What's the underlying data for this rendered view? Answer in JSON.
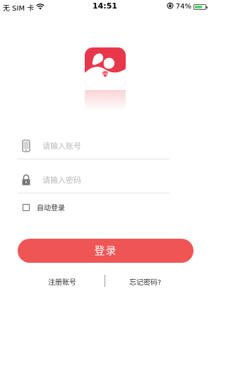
{
  "status_bar": {
    "carrier": "无 SIM 卡",
    "time": "14:51",
    "battery_percent": "74%",
    "battery_level": 0.74,
    "icons": [
      "wifi-icon",
      "orientation-lock-icon",
      "battery-icon"
    ]
  },
  "app": {
    "logo_icon": "app-logo-icon",
    "brand_color": "#e8374a"
  },
  "form": {
    "account": {
      "icon": "phone-icon",
      "placeholder": "请输入账号",
      "value": ""
    },
    "password": {
      "icon": "lock-icon",
      "placeholder": "请输入密码",
      "value": ""
    },
    "remember_label": "自动登录",
    "remember_checked": false
  },
  "login_button": {
    "label": "登录",
    "color": "#ef5555"
  },
  "links": {
    "register": "注册账号",
    "forgot": "忘记密码?"
  }
}
